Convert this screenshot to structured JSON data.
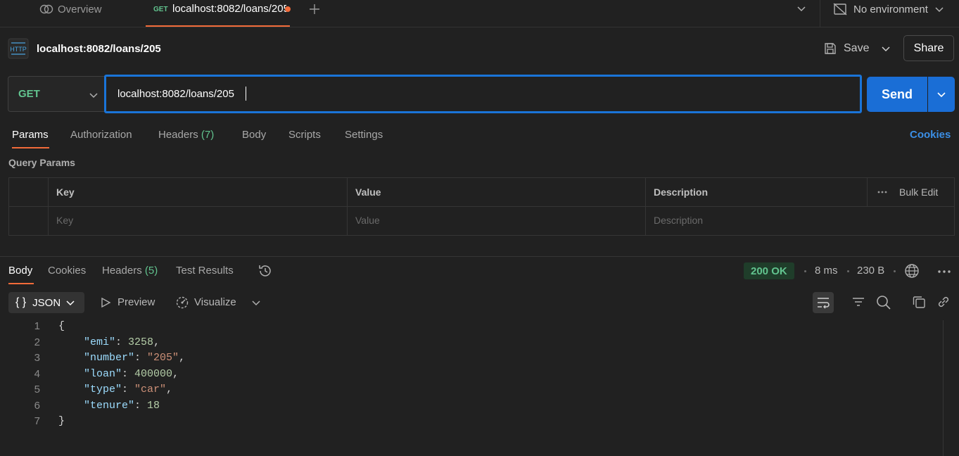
{
  "tabs": {
    "overview_label": "Overview",
    "active_method": "GET",
    "active_label": "localhost:8082/loans/205",
    "environment": "No environment"
  },
  "request": {
    "title": "localhost:8082/loans/205",
    "badge_text": "HTTP",
    "save_label": "Save",
    "share_label": "Share",
    "method": "GET",
    "url": "localhost:8082/loans/205",
    "send_label": "Send"
  },
  "request_tabs": [
    {
      "label": "Params",
      "count": ""
    },
    {
      "label": "Authorization",
      "count": ""
    },
    {
      "label": "Headers",
      "count": "(7)"
    },
    {
      "label": "Body",
      "count": ""
    },
    {
      "label": "Scripts",
      "count": ""
    },
    {
      "label": "Settings",
      "count": ""
    }
  ],
  "cookies_label": "Cookies",
  "query_params": {
    "title": "Query Params",
    "headers": {
      "key": "Key",
      "value": "Value",
      "description": "Description"
    },
    "bulk_edit": "Bulk Edit",
    "placeholders": {
      "key": "Key",
      "value": "Value",
      "description": "Description"
    }
  },
  "response": {
    "tabs": [
      {
        "label": "Body",
        "count": ""
      },
      {
        "label": "Cookies",
        "count": ""
      },
      {
        "label": "Headers",
        "count": "(5)"
      },
      {
        "label": "Test Results",
        "count": ""
      }
    ],
    "status": "200 OK",
    "time": "8 ms",
    "size": "230 B",
    "format": "JSON",
    "format_icon": "{ }",
    "preview_label": "Preview",
    "visualize_label": "Visualize",
    "status_color": "#62c48f"
  },
  "code_lines": [
    {
      "n": "1",
      "text": "{"
    },
    {
      "n": "2",
      "text": "    \"emi\": 3258,"
    },
    {
      "n": "3",
      "text": "    \"number\": \"205\","
    },
    {
      "n": "4",
      "text": "    \"loan\": 400000,"
    },
    {
      "n": "5",
      "text": "    \"type\": \"car\","
    },
    {
      "n": "6",
      "text": "    \"tenure\": 18"
    },
    {
      "n": "7",
      "text": "}"
    }
  ],
  "colors": {
    "accent": "#f26b3a",
    "primary": "#1a6ed6",
    "method_get": "#62c48f",
    "link": "#3b8fe6"
  }
}
